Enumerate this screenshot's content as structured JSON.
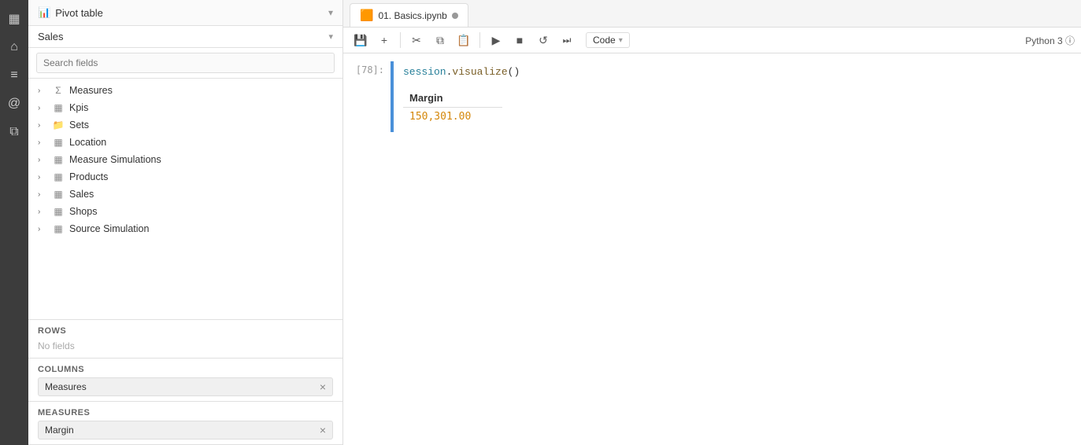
{
  "iconSidebar": {
    "items": [
      {
        "name": "table-icon",
        "symbol": "▦"
      },
      {
        "name": "home-icon",
        "symbol": "⌂"
      },
      {
        "name": "list-icon",
        "symbol": "≡"
      },
      {
        "name": "at-icon",
        "symbol": "@"
      },
      {
        "name": "puzzle-icon",
        "symbol": "⧉"
      }
    ]
  },
  "pivotPanel": {
    "header": {
      "icon": "📊",
      "title": "Pivot table",
      "chevron": "▾"
    },
    "salesDropdown": "Sales",
    "searchPlaceholder": "Search fields",
    "fieldGroups": [
      {
        "name": "Measures",
        "icon": "Σ",
        "type": "sigma"
      },
      {
        "name": "Kpis",
        "icon": "▦",
        "type": "grid"
      },
      {
        "name": "Sets",
        "icon": "📁",
        "type": "folder"
      },
      {
        "name": "Location",
        "icon": "▦",
        "type": "grid"
      },
      {
        "name": "Measure Simulations",
        "icon": "▦",
        "type": "grid"
      },
      {
        "name": "Products",
        "icon": "▦",
        "type": "grid"
      },
      {
        "name": "Sales",
        "icon": "▦",
        "type": "grid"
      },
      {
        "name": "Shops",
        "icon": "▦",
        "type": "grid"
      },
      {
        "name": "Source Simulation",
        "icon": "▦",
        "type": "grid"
      }
    ],
    "sections": {
      "rows": {
        "title": "Rows",
        "empty": "No fields",
        "pills": []
      },
      "columns": {
        "title": "Columns",
        "pills": [
          "Measures"
        ]
      },
      "measures": {
        "title": "Measures",
        "pills": [
          "Margin"
        ]
      }
    }
  },
  "notebook": {
    "tab": {
      "icon": "🟧",
      "label": "01. Basics.ipynb",
      "dotModified": true
    },
    "toolbar": {
      "save": "💾",
      "plus": "+",
      "cut": "✂",
      "copy": "⧉",
      "paste": "📋",
      "run": "▶",
      "stop": "■",
      "restart": "↺",
      "fastForward": "⏭",
      "codeType": "Code",
      "chevron": "▾",
      "pythonLabel": "Python 3 ⓘ"
    },
    "cells": [
      {
        "prompt": "[78]:",
        "code": "session.visualize()",
        "output": {
          "headers": [
            "Margin"
          ],
          "rows": [
            [
              "150,301.00"
            ]
          ]
        }
      }
    ]
  }
}
